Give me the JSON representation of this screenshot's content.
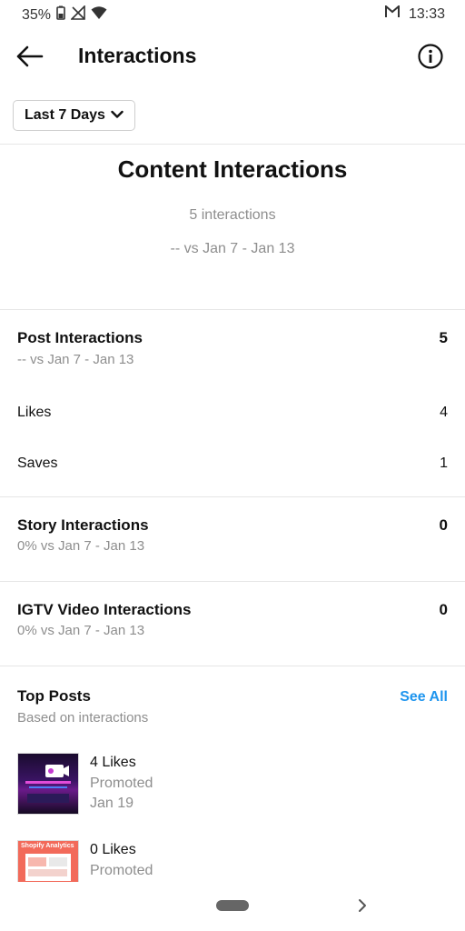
{
  "status": {
    "battery": "35%",
    "time": "13:33"
  },
  "header": {
    "title": "Interactions"
  },
  "filter": {
    "label": "Last 7 Days"
  },
  "content": {
    "title": "Content Interactions",
    "subtitle": "5 interactions",
    "comparison": "-- vs Jan 7 - Jan 13"
  },
  "post_interactions": {
    "label": "Post Interactions",
    "value": "5",
    "comparison": "-- vs Jan 7 - Jan 13",
    "rows": [
      {
        "label": "Likes",
        "value": "4"
      },
      {
        "label": "Saves",
        "value": "1"
      }
    ]
  },
  "story_interactions": {
    "label": "Story Interactions",
    "value": "0",
    "comparison": "0% vs Jan 7 - Jan 13"
  },
  "igtv_interactions": {
    "label": "IGTV Video Interactions",
    "value": "0",
    "comparison": "0% vs Jan 7 - Jan 13"
  },
  "top_posts": {
    "title": "Top Posts",
    "subtitle": "Based on interactions",
    "see_all": "See All",
    "items": [
      {
        "likes": "4 Likes",
        "status": "Promoted",
        "date": "Jan 19"
      },
      {
        "likes": "0 Likes",
        "status": "Promoted",
        "date": "",
        "thumb_text": "Shopify Analytics"
      }
    ]
  },
  "colors": {
    "link": "#1f95ee",
    "muted": "#8e8e8e",
    "divider": "#e6e6e6"
  }
}
